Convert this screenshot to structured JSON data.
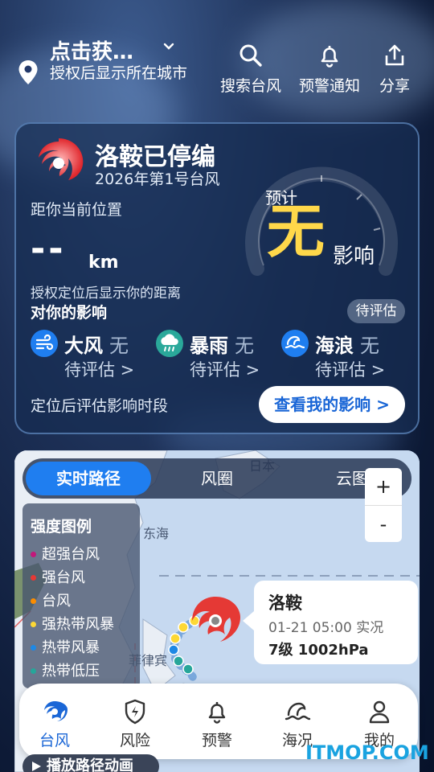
{
  "header": {
    "location_title": "点击获…",
    "location_subtitle": "授权后显示所在城市",
    "actions": [
      {
        "label": "搜索台风",
        "icon": "search-icon"
      },
      {
        "label": "预警通知",
        "icon": "bell-icon"
      },
      {
        "label": "分享",
        "icon": "share-icon"
      }
    ]
  },
  "typhoon_card": {
    "name_status": "洛鞍已停编",
    "subtitle": "2026年第1号台风",
    "distance_label": "距你当前位置",
    "distance_value": "--",
    "distance_unit": "km",
    "distance_note": "授权定位后显示你的距离",
    "impact_title": "对你的影响",
    "gauge_prefix": "预计",
    "gauge_value": "无",
    "gauge_suffix": "影响",
    "eval_badge": "待评估",
    "factors": [
      {
        "name": "大风",
        "value": "无",
        "sub": "待评估 >",
        "icon": "wind-icon",
        "color": "#1f7ef0"
      },
      {
        "name": "暴雨",
        "value": "无",
        "sub": "待评估 >",
        "icon": "rain-icon",
        "color": "#2aa89a"
      },
      {
        "name": "海浪",
        "value": "无",
        "sub": "待评估 >",
        "icon": "wave-icon",
        "color": "#1f7ef0"
      }
    ],
    "period_text": "定位后评估影响时段",
    "my_impact_button": "查看我的影响 >"
  },
  "map": {
    "tabs": [
      "实时路径",
      "风圈",
      "云图"
    ],
    "active_tab": 0,
    "zoom_in": "+",
    "zoom_out": "-",
    "legend_title": "强度图例",
    "legend": [
      {
        "label": "超强台风",
        "color": "#c2187a"
      },
      {
        "label": "强台风",
        "color": "#e53935"
      },
      {
        "label": "台风",
        "color": "#fb8c00"
      },
      {
        "label": "强热带风暴",
        "color": "#fdd835"
      },
      {
        "label": "热带风暴",
        "color": "#1e88e5"
      },
      {
        "label": "热带低压",
        "color": "#26a69a"
      }
    ],
    "labels": {
      "japan": "日本",
      "east_sea": "东海",
      "philippines": "菲律宾"
    },
    "callout": {
      "name": "洛鞍",
      "time": "01-21 05:00 实况",
      "level": "7级 1002hPa"
    },
    "play_button": "播放路径动画"
  },
  "nav": [
    {
      "label": "台风",
      "icon": "typhoon-icon",
      "active": true
    },
    {
      "label": "风险",
      "icon": "risk-shield-icon",
      "active": false
    },
    {
      "label": "预警",
      "icon": "bell-icon",
      "active": false
    },
    {
      "label": "海况",
      "icon": "wave-icon",
      "active": false
    },
    {
      "label": "我的",
      "icon": "user-icon",
      "active": false
    }
  ],
  "watermark": "ITMOP.COM",
  "colors": {
    "accent": "#1f7ef0",
    "gauge_value": "#ffd84a",
    "typhoon_red": "#e53935"
  }
}
